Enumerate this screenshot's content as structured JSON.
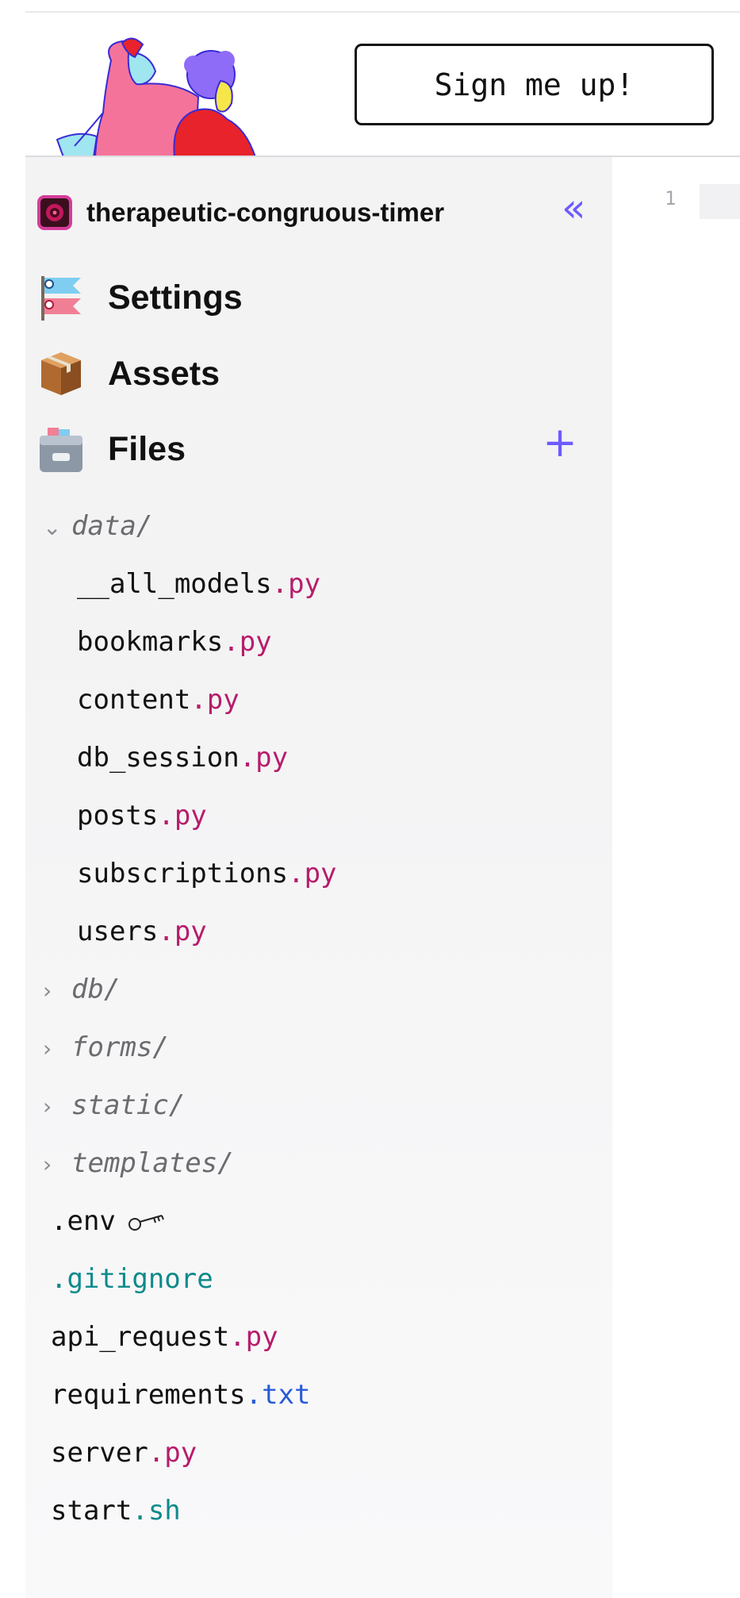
{
  "header": {
    "signup_label": "Sign me up!"
  },
  "project": {
    "name": "therapeutic-congruous-timer"
  },
  "editor": {
    "line_number": "1"
  },
  "nav": {
    "settings": "Settings",
    "assets": "Assets",
    "files": "Files"
  },
  "tree": {
    "data_folder": "data/",
    "data_files": [
      {
        "name": "__all_models",
        "ext": ".py"
      },
      {
        "name": "bookmarks",
        "ext": ".py"
      },
      {
        "name": "content",
        "ext": ".py"
      },
      {
        "name": "db_session",
        "ext": ".py"
      },
      {
        "name": "posts",
        "ext": ".py"
      },
      {
        "name": "subscriptions",
        "ext": ".py"
      },
      {
        "name": "users",
        "ext": ".py"
      }
    ],
    "folders": [
      "db/",
      "forms/",
      "static/",
      "templates/"
    ],
    "env_file": ".env",
    "gitignore_file": ".gitignore",
    "root_files": [
      {
        "name": "api_request",
        "ext": ".py"
      },
      {
        "name": "requirements",
        "ext": ".txt"
      },
      {
        "name": "server",
        "ext": ".py"
      },
      {
        "name": "start",
        "ext": ".sh"
      }
    ]
  },
  "colors": {
    "accent": "#6d5bff",
    "py_ext": "#b71c6b",
    "txt_ext": "#2a5bd7",
    "sh_ext": "#0e8a8a"
  },
  "icons": {
    "collapse": "chevrons-left-icon",
    "add": "plus-icon",
    "expanded": "chevron-down-icon",
    "collapsed": "chevron-right-icon",
    "env": "key-icon"
  }
}
